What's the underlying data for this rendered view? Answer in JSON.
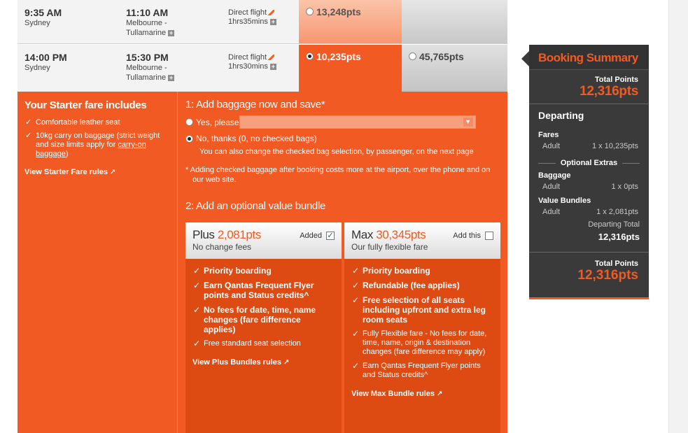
{
  "flights": [
    {
      "dep_time": "9:35 AM",
      "dep_city": "Sydney",
      "arr_time": "11:10 AM",
      "arr_city_1": "Melbourne -",
      "arr_city_2": "Tullamarine",
      "flight_type": "Direct flight",
      "duration": "1hrs35mins",
      "price_1": "13,248pts",
      "price_2": ""
    },
    {
      "dep_time": "14:00 PM",
      "dep_city": "Sydney",
      "arr_time": "15:30 PM",
      "arr_city_1": "Melbourne -",
      "arr_city_2": "Tullamarine",
      "flight_type": "Direct flight",
      "duration": "1hrs30mins",
      "price_1": "10,235pts",
      "price_2": "45,765pts"
    }
  ],
  "starter": {
    "title": "Your Starter fare includes",
    "items": [
      "Comfortable leather seat",
      "10kg carry on baggage (strict weight and size limits apply for "
    ],
    "carry_on_link": "carry-on baggage",
    "carry_on_close": ")",
    "rules_link": "View Starter Fare rules"
  },
  "baggage": {
    "title": "1: Add baggage now and save*",
    "yes_label": "Yes, please",
    "no_label": "No, thanks (0, no checked bags)",
    "note": "You can also change the checked bag selection, by passenger, on the next page",
    "footnote_1": "* Adding checked baggage after booking costs more at the airport, over the phone and on",
    "footnote_2": "our web site."
  },
  "bundle_section": {
    "title": "2: Add an optional value bundle"
  },
  "bundles": {
    "plus": {
      "name": "Plus",
      "price": "2,081pts",
      "subtitle": "No change fees",
      "toggle_label": "Added",
      "items": [
        "Priority boarding",
        "Earn Qantas Frequent Flyer points and Status credits^",
        "No fees for date, time, name changes (fare difference applies)",
        "Free standard seat selection"
      ],
      "rules_link": "View Plus Bundles rules"
    },
    "max": {
      "name": "Max",
      "price": "30,345pts",
      "subtitle": "Our fully flexible fare",
      "toggle_label": "Add this",
      "items": [
        "Priority boarding",
        "Refundable (fee applies)",
        "Free selection of all seats including upfront and extra leg room seats",
        "Fully Flexible fare - No fees for date, time, name, origin & destination changes (fare difference may apply)",
        "Earn Qantas Frequent Flyer points and Status credits^"
      ],
      "rules_link": "View Max Bundle rules"
    }
  },
  "summary": {
    "title": "Booking Summary",
    "total_label": "Total Points",
    "total_value": "12,316pts",
    "departing": "Departing",
    "fares_label": "Fares",
    "adult_label": "Adult",
    "fares_value": "1 x 10,235pts",
    "optional_extras": "Optional Extras",
    "baggage_label": "Baggage",
    "baggage_value": "1 x 0pts",
    "bundles_label": "Value Bundles",
    "bundles_value": "1 x 2,081pts",
    "departing_total_label": "Departing Total",
    "departing_total_value": "12,316pts",
    "final_total_label": "Total Points",
    "final_total_value": "12,316pts"
  },
  "colors": {
    "brand_orange": "#f15a22",
    "dark_panel": "#3a3a3a"
  }
}
